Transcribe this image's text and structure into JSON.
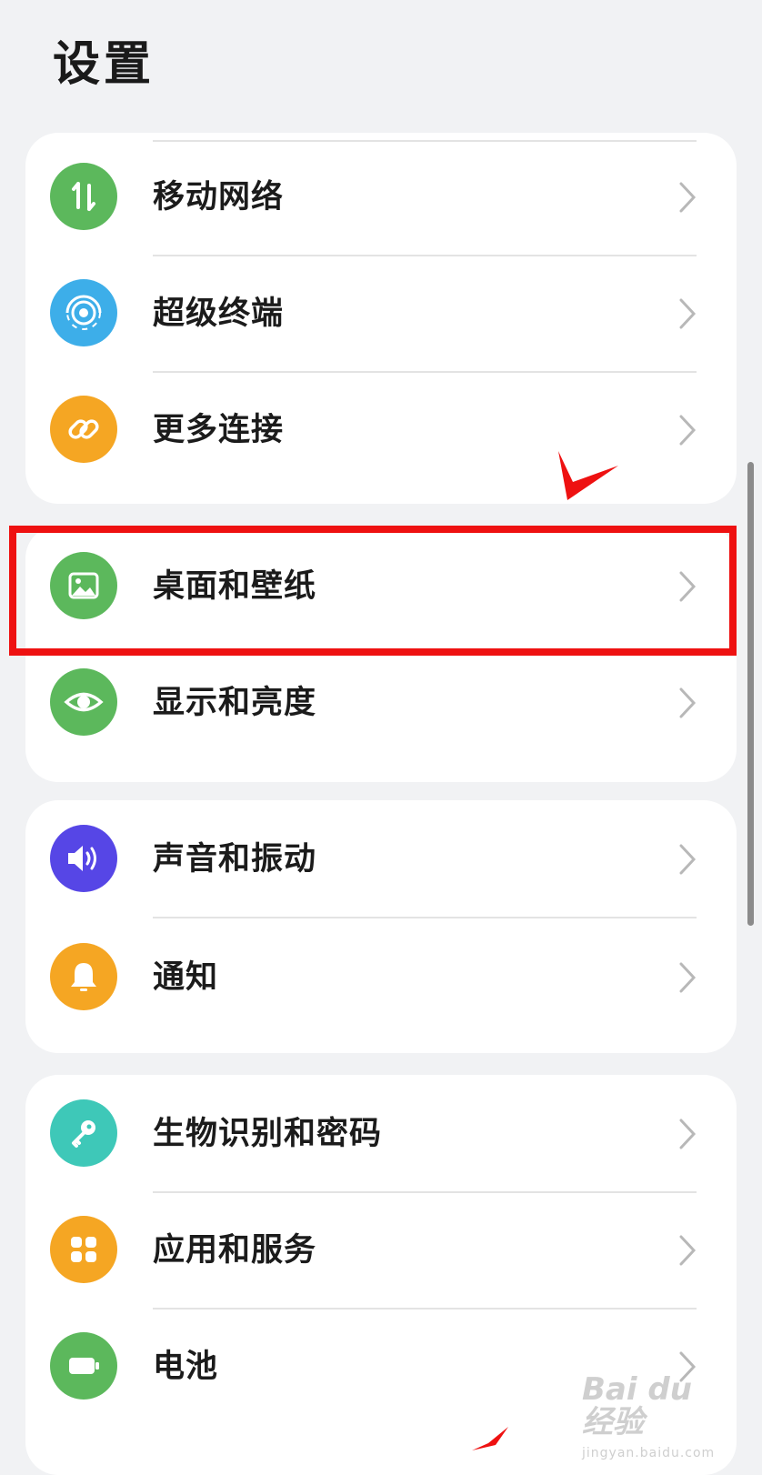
{
  "header": {
    "title": "设置"
  },
  "groups": [
    {
      "items": [
        {
          "label": "移动网络",
          "icon": "mobile-data-icon",
          "color": "#5cb85c"
        },
        {
          "label": "超级终端",
          "icon": "super-device-icon",
          "color": "#3daee9"
        },
        {
          "label": "更多连接",
          "icon": "link-icon",
          "color": "#f5a623"
        }
      ]
    },
    {
      "items": [
        {
          "label": "桌面和壁纸",
          "icon": "wallpaper-icon",
          "color": "#5cb85c"
        },
        {
          "label": "显示和亮度",
          "icon": "eye-icon",
          "color": "#5cb85c"
        }
      ]
    },
    {
      "items": [
        {
          "label": "声音和振动",
          "icon": "speaker-icon",
          "color": "#5646e6"
        },
        {
          "label": "通知",
          "icon": "bell-icon",
          "color": "#f5a623"
        }
      ]
    },
    {
      "items": [
        {
          "label": "生物识别和密码",
          "icon": "key-icon",
          "color": "#3ec8b8"
        },
        {
          "label": "应用和服务",
          "icon": "apps-icon",
          "color": "#f5a623"
        },
        {
          "label": "电池",
          "icon": "battery-icon",
          "color": "#5cb85c"
        }
      ]
    }
  ],
  "annotation": {
    "highlight_color": "#ee1111"
  },
  "watermark": {
    "main": "Bai du 经验",
    "sub": "jingyan.baidu.com"
  }
}
